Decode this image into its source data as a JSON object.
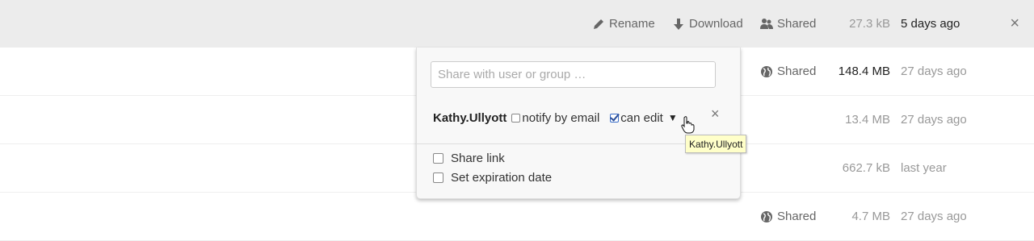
{
  "selected_row": {
    "actions": {
      "rename": "Rename",
      "download": "Download",
      "shared": "Shared"
    },
    "size": "27.3 kB",
    "date": "5 days ago",
    "close_icon": "×"
  },
  "rows": [
    {
      "shared": "Shared",
      "size": "148.4 MB",
      "date": "27 days ago"
    },
    {
      "size": "13.4 MB",
      "date": "27 days ago"
    },
    {
      "size": "662.7 kB",
      "date": "last year"
    },
    {
      "shared": "Shared",
      "size": "4.7 MB",
      "date": "27 days ago"
    }
  ],
  "share_dropdown": {
    "input_placeholder": "Share with user or group …",
    "share_entry": {
      "user": "Kathy.Ullyott",
      "notify_label": "notify by email",
      "notify_checked": false,
      "can_edit_label": "can edit",
      "can_edit_checked": true,
      "dropdown_arrow": "▼",
      "remove_icon": "×"
    },
    "share_link_label": "Share link",
    "expiration_label": "Set expiration date",
    "tooltip": "Kathy.Ullyott"
  },
  "icons": {
    "rename": "pencil-icon",
    "download": "download-arrow-icon",
    "shared_users": "users-icon",
    "shared_link": "globe-icon",
    "cursor": "hand-pointer-icon"
  }
}
